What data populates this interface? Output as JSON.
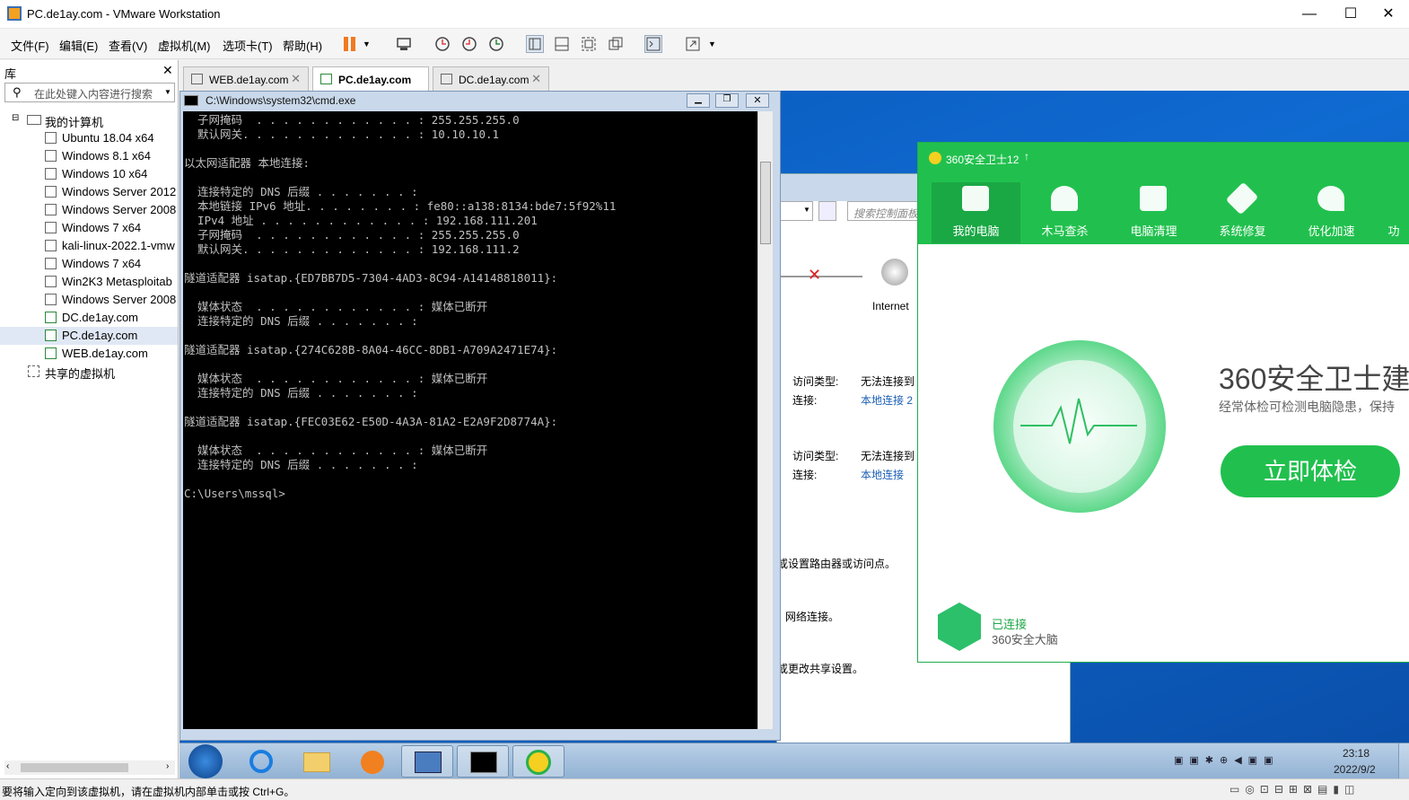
{
  "window": {
    "title": "PC.de1ay.com - VMware Workstation"
  },
  "menu": [
    "文件(F)",
    "编辑(E)",
    "查看(V)",
    "虚拟机(M)",
    "选项卡(T)",
    "帮助(H)"
  ],
  "library": {
    "title": "库",
    "search_placeholder": "在此处键入内容进行搜索",
    "root": "我的计算机",
    "items": [
      "Ubuntu 18.04 x64",
      "Windows 8.1 x64",
      "Windows 10 x64",
      "Windows Server 2012",
      "Windows Server 2008",
      "Windows 7 x64",
      "kali-linux-2022.1-vmw",
      "Windows 7 x64",
      "Win2K3 Metasploitab",
      "Windows Server 2008",
      "DC.de1ay.com",
      "PC.de1ay.com",
      "WEB.de1ay.com"
    ],
    "shared": "共享的虚拟机"
  },
  "tabs": [
    {
      "label": "WEB.de1ay.com",
      "active": false
    },
    {
      "label": "PC.de1ay.com",
      "active": true
    },
    {
      "label": "DC.de1ay.com",
      "active": false
    }
  ],
  "cmd": {
    "title": "C:\\Windows\\system32\\cmd.exe",
    "lines": [
      "  子网掩码  . . . . . . . . . . . . : 255.255.255.0",
      "  默认网关. . . . . . . . . . . . . : 10.10.10.1",
      "",
      "以太网适配器 本地连接:",
      "",
      "  连接特定的 DNS 后缀 . . . . . . . :",
      "  本地链接 IPv6 地址. . . . . . . . : fe80::a138:8134:bde7:5f92%11",
      "  IPv4 地址 . . . . . . . . . . . . : 192.168.111.201",
      "  子网掩码  . . . . . . . . . . . . : 255.255.255.0",
      "  默认网关. . . . . . . . . . . . . : 192.168.111.2",
      "",
      "隧道适配器 isatap.{ED7BB7D5-7304-4AD3-8C94-A14148818011}:",
      "",
      "  媒体状态  . . . . . . . . . . . . : 媒体已断开",
      "  连接特定的 DNS 后缀 . . . . . . . :",
      "",
      "隧道适配器 isatap.{274C628B-8A04-46CC-8DB1-A709A2471E74}:",
      "",
      "  媒体状态  . . . . . . . . . . . . : 媒体已断开",
      "  连接特定的 DNS 后缀 . . . . . . . :",
      "",
      "隧道适配器 isatap.{FEC03E62-E50D-4A3A-81A2-E2A9F2D8774A}:",
      "",
      "  媒体状态  . . . . . . . . . . . . : 媒体已断开",
      "  连接特定的 DNS 后缀 . . . . . . . :",
      "",
      "C:\\Users\\mssql>"
    ]
  },
  "controlpanel": {
    "search_placeholder": "搜索控制面板",
    "internet_label": "Internet",
    "access_type": "访问类型:",
    "no_internet": "无法连接到",
    "connection": "连接:",
    "conn1": "本地连接 2",
    "conn2": "本地连接",
    "text1": "或设置路由器或访问点。",
    "text2": "网络连接。",
    "text3": "或更改共享设置。"
  },
  "security360": {
    "title": "360安全卫士12",
    "nav": [
      "我的电脑",
      "木马查杀",
      "电脑清理",
      "系统修复",
      "优化加速",
      "功"
    ],
    "headline": "360安全卫士建",
    "subline": "经常体检可检测电脑隐患，保持",
    "button": "立即体检",
    "status_connected": "已连接",
    "status_brain": "360安全大脑",
    "accent": "#21c04e"
  },
  "taskbar": {
    "time": "23:18",
    "date": "2022/9/2"
  },
  "statusbar": {
    "message": "要将输入定向到该虚拟机，请在虚拟机内部单击或按 Ctrl+G。"
  }
}
